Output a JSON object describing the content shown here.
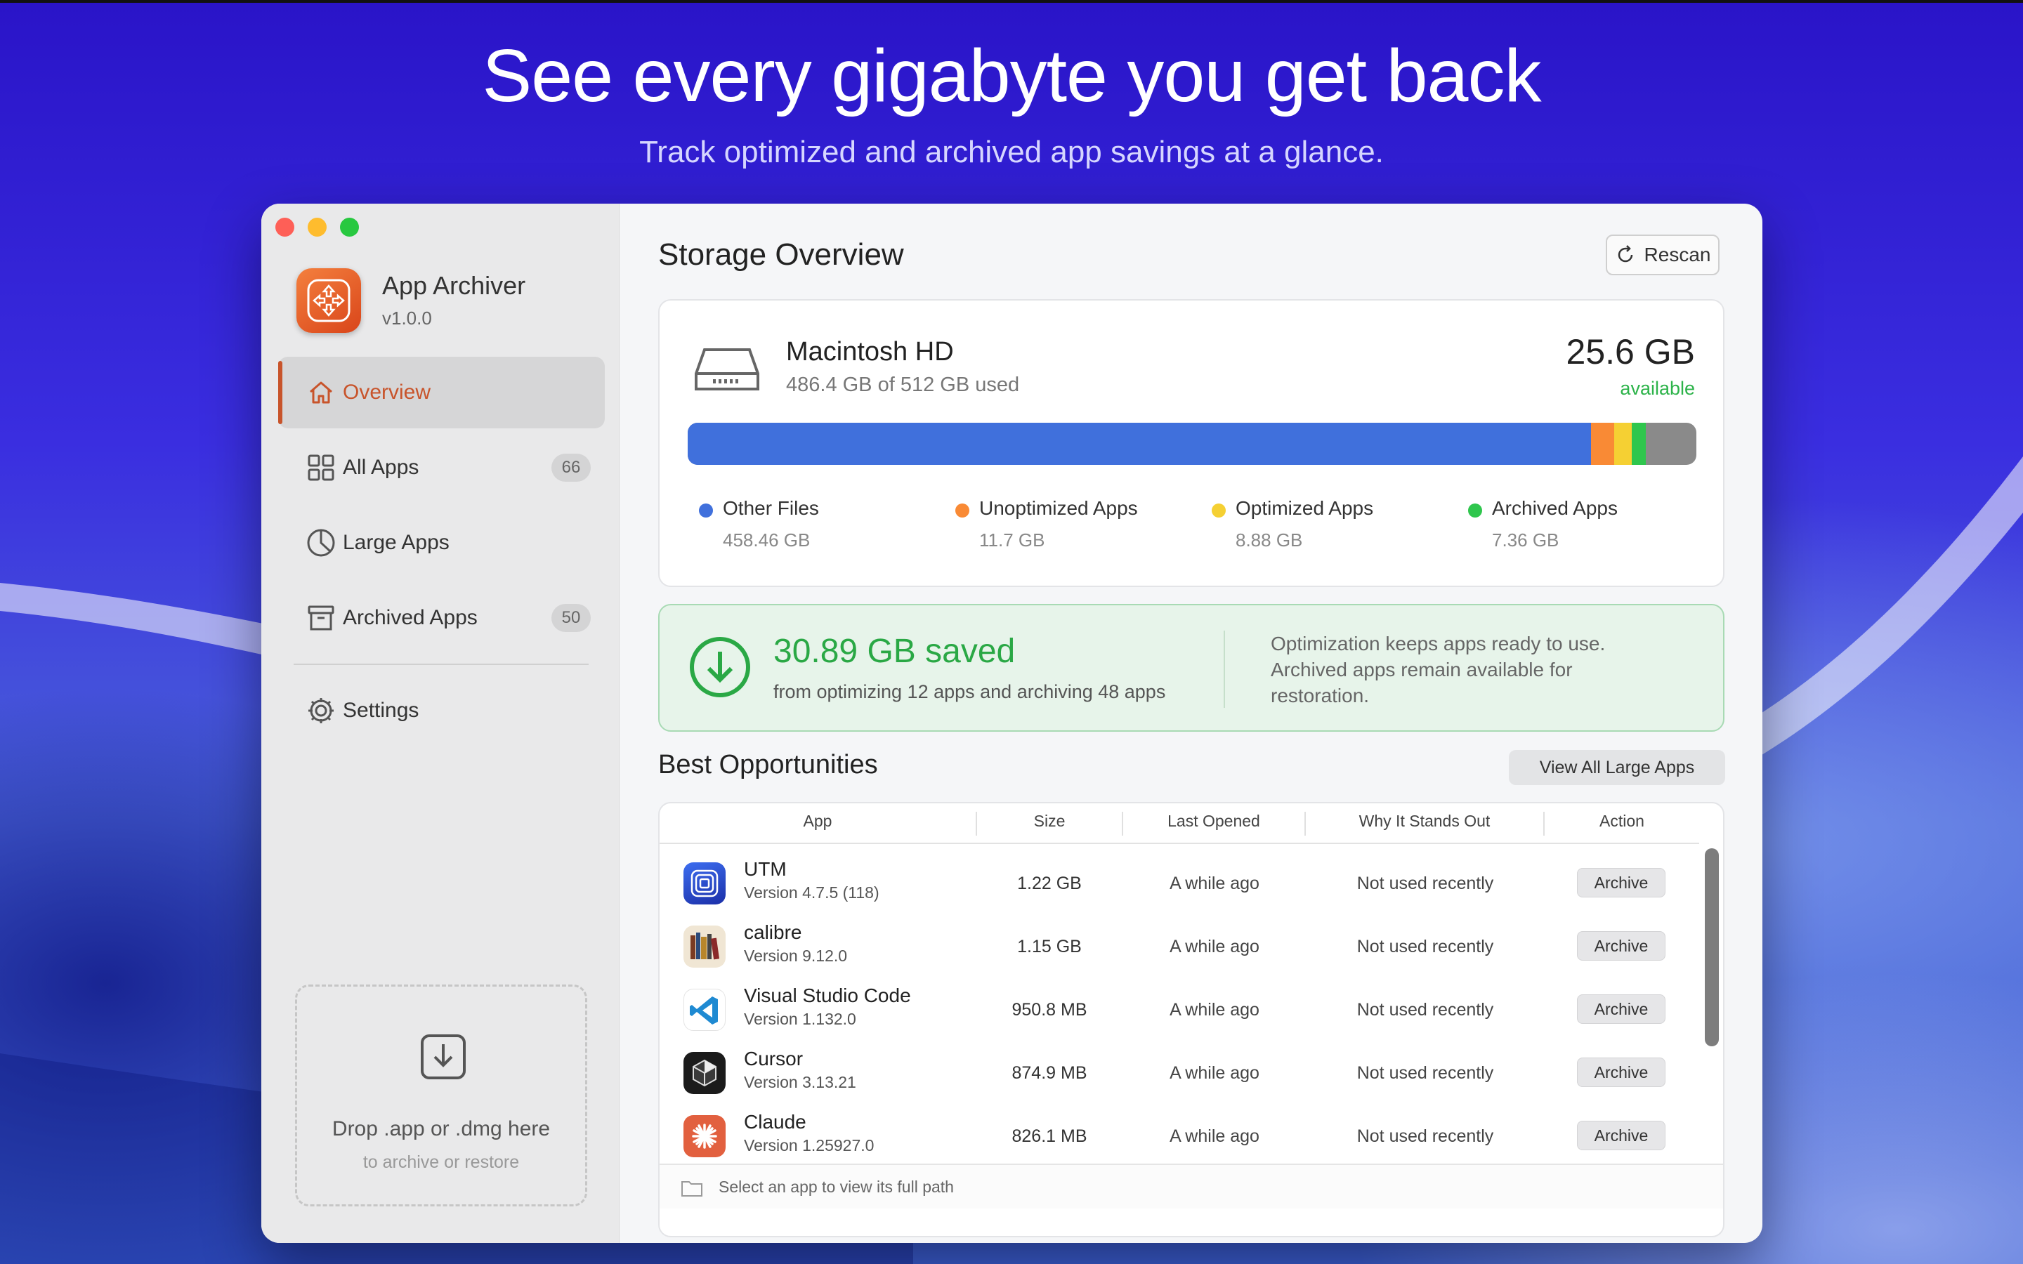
{
  "hero": {
    "title": "See every gigabyte you get back",
    "subtitle": "Track optimized and archived app savings at a glance."
  },
  "sidebar": {
    "app_name": "App Archiver",
    "version": "v1.0.0",
    "items": [
      {
        "label": "Overview",
        "icon": "home-icon",
        "active": true
      },
      {
        "label": "All Apps",
        "icon": "grid-icon",
        "badge": "66"
      },
      {
        "label": "Large Apps",
        "icon": "pie-chart-icon"
      },
      {
        "label": "Archived Apps",
        "icon": "archive-box-icon",
        "badge": "50"
      },
      {
        "label": "Settings",
        "icon": "gear-icon"
      }
    ],
    "drop_zone": {
      "title": "Drop .app or .dmg here",
      "subtitle": "to archive or restore"
    }
  },
  "main": {
    "title": "Storage Overview",
    "rescan_label": "Rescan",
    "disk": {
      "name": "Macintosh HD",
      "usage": "486.4 GB of 512 GB used",
      "available_value": "25.6 GB",
      "available_label": "available",
      "segments": [
        {
          "name": "Other Files",
          "value": "458.46 GB",
          "gb": 458.46,
          "color": "#4070dc"
        },
        {
          "name": "Unoptimized Apps",
          "value": "11.7 GB",
          "gb": 11.7,
          "color": "#f98a35"
        },
        {
          "name": "Optimized Apps",
          "value": "8.88 GB",
          "gb": 8.88,
          "color": "#f5d033"
        },
        {
          "name": "Archived Apps",
          "value": "7.36 GB",
          "gb": 7.36,
          "color": "#2fc64d"
        }
      ],
      "free_color": "#8a8a8a",
      "total_gb": 512
    },
    "savings": {
      "headline": "30.89 GB saved",
      "detail": "from optimizing 12 apps and archiving 48 apps",
      "note": "Optimization keeps apps ready to use. Archived apps remain available for restoration."
    },
    "opportunities": {
      "title": "Best Opportunities",
      "view_all_label": "View All Large Apps",
      "columns": [
        "App",
        "Size",
        "Last Opened",
        "Why It Stands Out",
        "Action"
      ],
      "rows": [
        {
          "name": "UTM",
          "version": "Version 4.7.5 (118)",
          "size": "1.22 GB",
          "last_opened": "A while ago",
          "why": "Not used recently",
          "action": "Archive"
        },
        {
          "name": "calibre",
          "version": "Version 9.12.0",
          "size": "1.15 GB",
          "last_opened": "A while ago",
          "why": "Not used recently",
          "action": "Archive"
        },
        {
          "name": "Visual Studio Code",
          "version": "Version 1.132.0",
          "size": "950.8 MB",
          "last_opened": "A while ago",
          "why": "Not used recently",
          "action": "Archive"
        },
        {
          "name": "Cursor",
          "version": "Version 3.13.21",
          "size": "874.9 MB",
          "last_opened": "A while ago",
          "why": "Not used recently",
          "action": "Archive"
        },
        {
          "name": "Claude",
          "version": "Version 1.25927.0",
          "size": "826.1 MB",
          "last_opened": "A while ago",
          "why": "Not used recently",
          "action": "Archive"
        }
      ],
      "footer": "Select an app to view its full path"
    }
  }
}
